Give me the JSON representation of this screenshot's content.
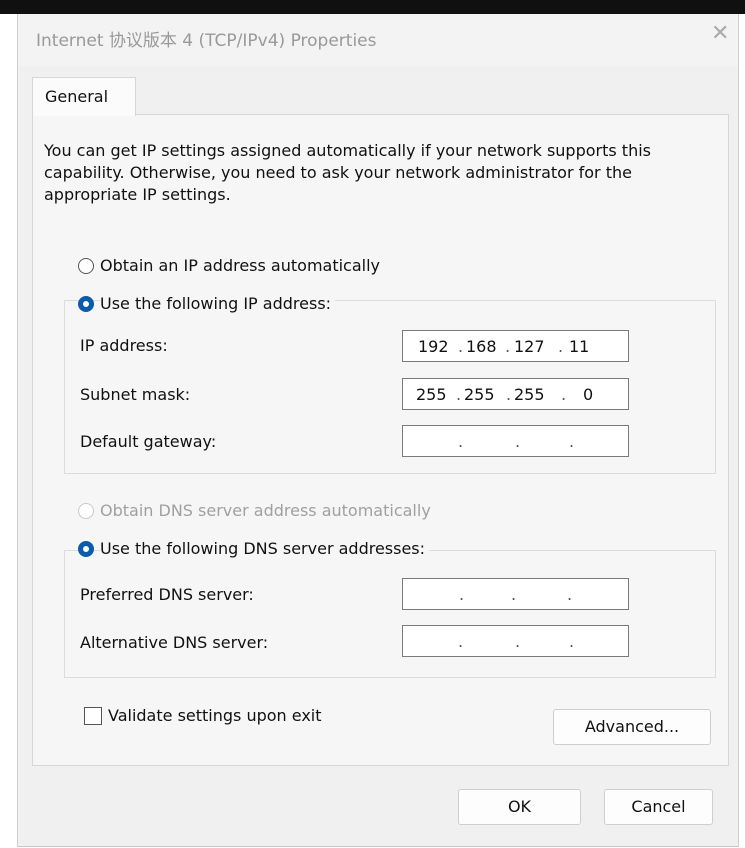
{
  "window": {
    "title": "Internet 协议版本 4 (TCP/IPv4) Properties",
    "close_glyph": "✕"
  },
  "tabs": [
    {
      "label": "General"
    }
  ],
  "description": "You can get IP settings assigned automatically if your network supports this capability. Otherwise, you need to ask your network administrator for the appropriate IP settings.",
  "ip_mode": {
    "auto_label": "Obtain an IP address automatically",
    "manual_label": "Use the following IP address:",
    "selected": "manual"
  },
  "ip_fields": {
    "ip_address": {
      "label": "IP address:",
      "octets": [
        "192",
        "168",
        "127",
        "11"
      ]
    },
    "subnet_mask": {
      "label": "Subnet mask:",
      "octets": [
        "255",
        "255",
        "255",
        "0"
      ]
    },
    "default_gateway": {
      "label": "Default gateway:",
      "octets": [
        "",
        "",
        "",
        ""
      ]
    }
  },
  "dns_mode": {
    "auto_label": "Obtain DNS server address automatically",
    "manual_label": "Use the following DNS server addresses:",
    "selected": "manual"
  },
  "dns_fields": {
    "preferred": {
      "label": "Preferred DNS server:",
      "octets": [
        "",
        "",
        "",
        ""
      ]
    },
    "alternative": {
      "label": "Alternative DNS server:",
      "octets": [
        "",
        "",
        "",
        ""
      ]
    }
  },
  "validate": {
    "label": "Validate settings upon exit",
    "checked": false
  },
  "buttons": {
    "advanced": "Advanced...",
    "ok": "OK",
    "cancel": "Cancel"
  },
  "colors": {
    "radio_selected": "#0b5cad",
    "dialog_bg": "#f0f0f0"
  }
}
